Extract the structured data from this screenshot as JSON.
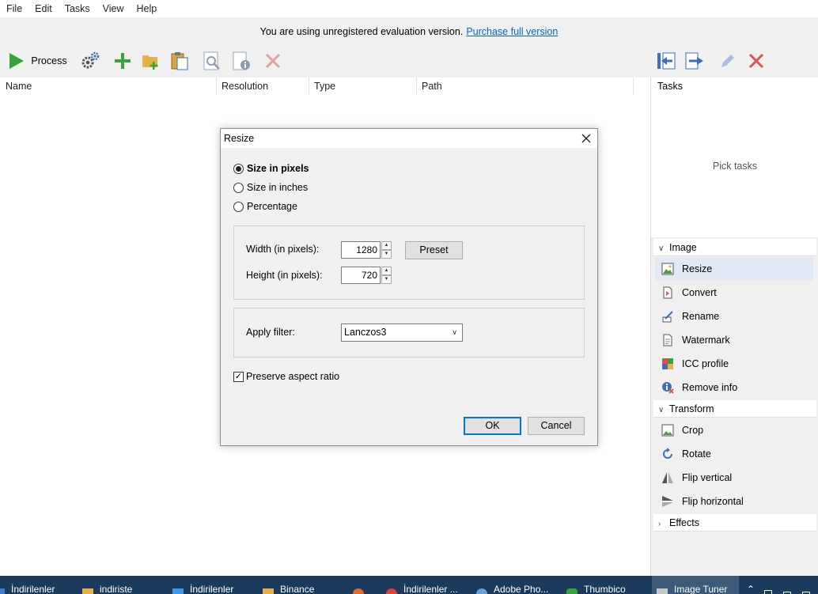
{
  "menu": [
    "File",
    "Edit",
    "Tasks",
    "View",
    "Help"
  ],
  "eval_notice": {
    "text": "You are using unregistered evaluation version.",
    "link": "Purchase full version"
  },
  "toolbar": {
    "process_label": "Process"
  },
  "list": {
    "columns": [
      "Name",
      "Resolution",
      "Type",
      "Path"
    ]
  },
  "tasks_panel": {
    "header": "Tasks",
    "placeholder": "Pick tasks",
    "groups": [
      {
        "label": "Image",
        "expanded": true,
        "items": [
          {
            "label": "Resize",
            "icon": "resize-icon",
            "selected": true
          },
          {
            "label": "Convert",
            "icon": "convert-icon"
          },
          {
            "label": "Rename",
            "icon": "rename-icon"
          },
          {
            "label": "Watermark",
            "icon": "watermark-icon"
          },
          {
            "label": "ICC profile",
            "icon": "icc-profile-icon"
          },
          {
            "label": "Remove info",
            "icon": "remove-info-icon"
          }
        ]
      },
      {
        "label": "Transform",
        "expanded": true,
        "items": [
          {
            "label": "Crop",
            "icon": "crop-icon"
          },
          {
            "label": "Rotate",
            "icon": "rotate-icon"
          },
          {
            "label": "Flip vertical",
            "icon": "flip-vertical-icon"
          },
          {
            "label": "Flip horizontal",
            "icon": "flip-horizontal-icon"
          }
        ]
      },
      {
        "label": "Effects",
        "expanded": false,
        "items": []
      }
    ]
  },
  "dialog": {
    "title": "Resize",
    "modes": [
      {
        "label": "Size in pixels",
        "selected": true
      },
      {
        "label": "Size in inches",
        "selected": false
      },
      {
        "label": "Percentage",
        "selected": false
      }
    ],
    "width_label": "Width (in pixels):",
    "width_value": "1280",
    "height_label": "Height (in pixels):",
    "height_value": "720",
    "preset_label": "Preset",
    "filter_label": "Apply filter:",
    "filter_value": "Lanczos3",
    "preserve_label": "Preserve aspect ratio",
    "preserve_checked": true,
    "ok_label": "OK",
    "cancel_label": "Cancel"
  },
  "taskbar": {
    "items": [
      "İndirilenler",
      "indiriste",
      "İndirilenler",
      "Binance",
      "",
      "İndirilenler ...",
      "Adobe Pho...",
      "Thumbico",
      "Image Tuner"
    ]
  },
  "colors": {
    "accent_green": "#3aa23a",
    "delete_red": "#d9534f",
    "link_blue": "#0066cc",
    "taskbar": "#1b3a5c"
  }
}
